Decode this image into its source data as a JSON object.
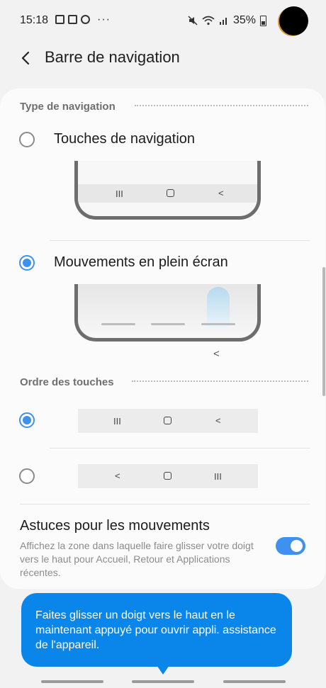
{
  "status": {
    "time": "15:18",
    "more": "···",
    "battery": "35%",
    "icons": [
      "gallery-icon",
      "image-icon",
      "basketball-icon",
      "mute-icon",
      "wifi-icon",
      "signal-icon",
      "battery-icon"
    ]
  },
  "header": {
    "title": "Barre de navigation"
  },
  "navigation_type": {
    "section_title": "Type de navigation",
    "options": [
      {
        "label": "Touches de navigation",
        "selected": false
      },
      {
        "label": "Mouvements en plein écran",
        "selected": true
      }
    ]
  },
  "button_order": {
    "section_title": "Ordre des touches",
    "options": [
      {
        "order": [
          "recents",
          "home",
          "back"
        ],
        "selected": true
      },
      {
        "order": [
          "back",
          "home",
          "recents"
        ],
        "selected": false
      }
    ]
  },
  "gesture_tips": {
    "title": "Astuces pour les mouvements",
    "description": "Affichez la zone dans laquelle faire glisser votre doigt vers le haut pour Accueil, Retour et Applications récentes.",
    "enabled": true
  },
  "tooltip": {
    "text": "Faites glisser un doigt vers le haut en le maintenant appuyé pour ouvrir appli. assistance de l'appareil."
  },
  "glyphs": {
    "recents": "III",
    "back": "<"
  },
  "colors": {
    "accent": "#3e91ee",
    "tooltip_bg": "#0a86ea",
    "background": "#f2f2f2",
    "card": "#fbfbfb"
  }
}
